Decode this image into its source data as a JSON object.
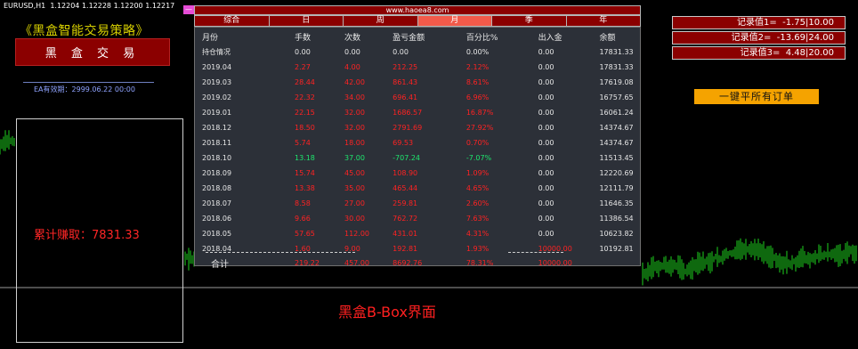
{
  "header": {
    "symbol": "EURUSD,H1",
    "ohlc": "1.12204 1.12228 1.12200 1.12217"
  },
  "left": {
    "strategy_title": "《黑盒智能交易策略》",
    "brand": "黑 盒 交 易",
    "ea_valid": "EA有效期：2999.06.22 00:00",
    "profit_label": "累计赚取：7831.33"
  },
  "caption": "黑盒B-Box界面",
  "panel": {
    "handle": "—",
    "url": "www.haoea8.com",
    "tabs": [
      "综合",
      "日",
      "周",
      "月",
      "季",
      "年"
    ],
    "active_tab": "月",
    "columns": [
      "月份",
      "手数",
      "次数",
      "盈亏金额",
      "百分比%",
      "出入金",
      "余额"
    ],
    "rows": [
      {
        "month": "持仓情况",
        "lots": "0.00",
        "count": "0.00",
        "pnl": "0.00",
        "pct": "0.00%",
        "flow": "0.00",
        "balance": "17831.33",
        "tone": "neutral"
      },
      {
        "month": "2019.04",
        "lots": "2.27",
        "count": "4.00",
        "pnl": "212.25",
        "pct": "2.12%",
        "flow": "0.00",
        "balance": "17831.33",
        "tone": "up"
      },
      {
        "month": "2019.03",
        "lots": "28.44",
        "count": "42.00",
        "pnl": "861.43",
        "pct": "8.61%",
        "flow": "0.00",
        "balance": "17619.08",
        "tone": "up"
      },
      {
        "month": "2019.02",
        "lots": "22.32",
        "count": "34.00",
        "pnl": "696.41",
        "pct": "6.96%",
        "flow": "0.00",
        "balance": "16757.65",
        "tone": "up"
      },
      {
        "month": "2019.01",
        "lots": "22.15",
        "count": "32.00",
        "pnl": "1686.57",
        "pct": "16.87%",
        "flow": "0.00",
        "balance": "16061.24",
        "tone": "up"
      },
      {
        "month": "2018.12",
        "lots": "18.50",
        "count": "32.00",
        "pnl": "2791.69",
        "pct": "27.92%",
        "flow": "0.00",
        "balance": "14374.67",
        "tone": "up"
      },
      {
        "month": "2018.11",
        "lots": "5.74",
        "count": "18.00",
        "pnl": "69.53",
        "pct": "0.70%",
        "flow": "0.00",
        "balance": "14374.67",
        "tone": "up"
      },
      {
        "month": "2018.10",
        "lots": "13.18",
        "count": "37.00",
        "pnl": "-707.24",
        "pct": "-7.07%",
        "flow": "0.00",
        "balance": "11513.45",
        "tone": "down"
      },
      {
        "month": "2018.09",
        "lots": "15.74",
        "count": "45.00",
        "pnl": "108.90",
        "pct": "1.09%",
        "flow": "0.00",
        "balance": "12220.69",
        "tone": "up"
      },
      {
        "month": "2018.08",
        "lots": "13.38",
        "count": "35.00",
        "pnl": "465.44",
        "pct": "4.65%",
        "flow": "0.00",
        "balance": "12111.79",
        "tone": "up"
      },
      {
        "month": "2018.07",
        "lots": "8.58",
        "count": "27.00",
        "pnl": "259.81",
        "pct": "2.60%",
        "flow": "0.00",
        "balance": "11646.35",
        "tone": "up"
      },
      {
        "month": "2018.06",
        "lots": "9.66",
        "count": "30.00",
        "pnl": "762.72",
        "pct": "7.63%",
        "flow": "0.00",
        "balance": "11386.54",
        "tone": "up"
      },
      {
        "month": "2018.05",
        "lots": "57.65",
        "count": "112.00",
        "pnl": "431.01",
        "pct": "4.31%",
        "flow": "0.00",
        "balance": "10623.82",
        "tone": "up"
      },
      {
        "month": "2018.04",
        "lots": "1.60",
        "count": "9.00",
        "pnl": "192.81",
        "pct": "1.93%",
        "flow": "10000.00",
        "balance": "10192.81",
        "tone": "up"
      }
    ],
    "total": {
      "label": "合计",
      "lots": "219.22",
      "count": "457.00",
      "pnl": "8692.76",
      "pct": "78.31%",
      "flow": "10000.00"
    }
  },
  "records": [
    {
      "label": "记录值1=",
      "value": "-1.75|10.00"
    },
    {
      "label": "记录值2=",
      "value": "-13.69|24.00"
    },
    {
      "label": "记录值3=",
      "value": "4.48|20.00"
    }
  ],
  "close_all_button": "一键平所有订单",
  "colors": {
    "up": "#ff2222",
    "down": "#1ee66e",
    "neutral": "#e6e6e6",
    "accent": "#8b0000",
    "button": "#f5a300"
  }
}
